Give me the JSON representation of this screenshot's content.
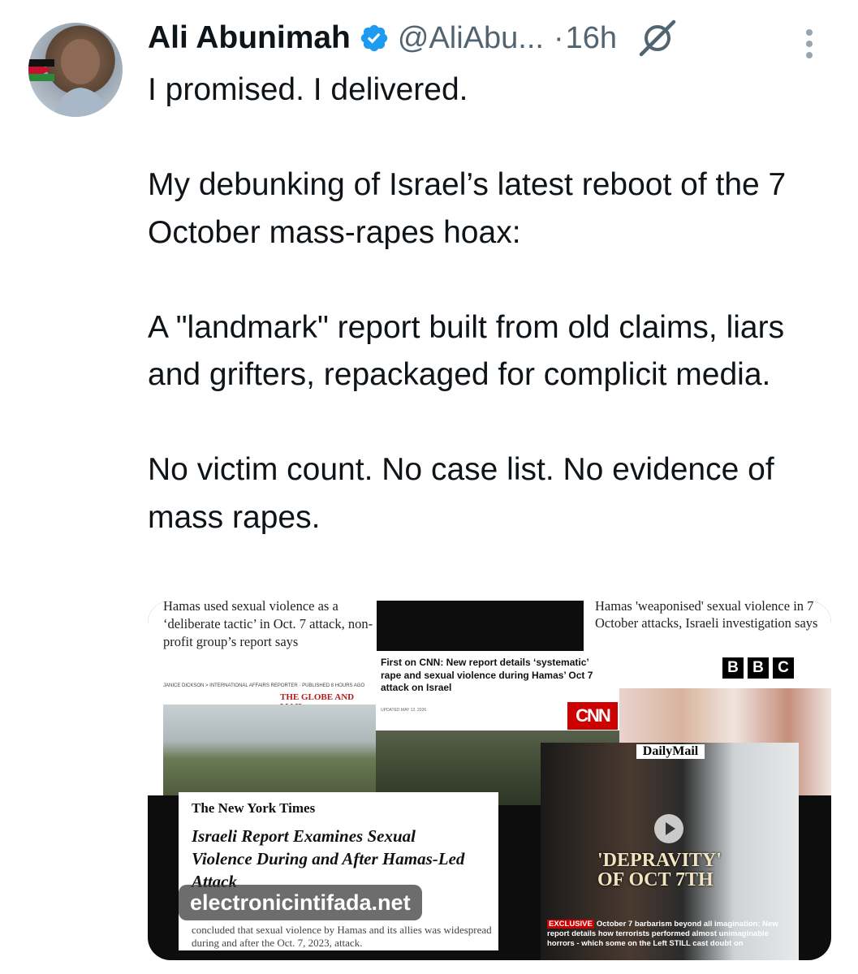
{
  "tweet": {
    "author_name": "Ali Abunimah",
    "handle": "@AliAbu...",
    "separator": "·",
    "time": "16h",
    "paragraphs": [
      "I promised. I delivered.",
      "My debunking of Israel’s latest reboot of the 7 October mass-rapes hoax:",
      "A \"landmark\" report built from old claims, liars and grifters, repackaged for complicit media.",
      "No victim count. No case list. No evidence of mass rapes."
    ]
  },
  "media": {
    "globe": {
      "headline": "Hamas used sexual violence as a ‘deliberate tactic’ in Oct. 7 attack, non-profit group’s report says",
      "byline": "JANICE DICKSON > INTERNATIONAL AFFAIRS REPORTER · PUBLISHED 8 HOURS AGO",
      "masthead": "THE GLOBE AND MAIL"
    },
    "bbc": {
      "headline": "Hamas 'weaponised' sexual violence in 7 October attacks, Israeli investigation says",
      "logo_letters": [
        "B",
        "B",
        "C"
      ]
    },
    "cnn": {
      "headline": "First on CNN: New report details ‘systematic’ rape and sexual violence during Hamas’ Oct 7 attack on Israel",
      "meta": "UPDATED MAY 12, 2026",
      "logo": "CNN"
    },
    "dailymail": {
      "logo": "DailyMail",
      "title_line1": "'DEPRAVITY'",
      "title_line2": "OF OCT 7TH",
      "exclusive": "EXCLUSIVE",
      "caption": "October 7 barbarism beyond all imagination: New report details how terrorists performed almost unimaginable horrors - which some on the Left STILL cast doubt on"
    },
    "nyt": {
      "masthead": "The New York Times",
      "headline": "Israeli Report Examines Sexual Violence During and After Hamas-Led Attack",
      "sub": "concluded that sexual violence by Hamas and its allies was widespread during and after the Oct. 7, 2023, attack."
    },
    "watermark": "electronicintifada.net"
  },
  "colors": {
    "verified": "#1d9bf0",
    "secondary_text": "#536471",
    "text": "#0f1419"
  }
}
